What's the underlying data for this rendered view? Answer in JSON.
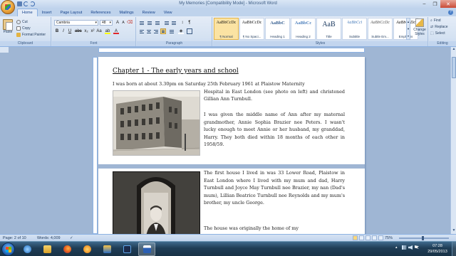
{
  "window": {
    "title": "My Memories [Compatibility Mode] - Microsoft Word",
    "minimize": "–",
    "maximize": "❐",
    "close": "✕"
  },
  "tabs": [
    "Home",
    "Insert",
    "Page Layout",
    "References",
    "Mailings",
    "Review",
    "View"
  ],
  "ribbon": {
    "clipboard": {
      "label": "Clipboard",
      "paste": "Paste",
      "cut": "Cut",
      "copy": "Copy",
      "format_painter": "Format Painter"
    },
    "font": {
      "label": "Font",
      "family": "Cambria",
      "size": "48",
      "bold": "B",
      "italic": "I",
      "underline": "U"
    },
    "paragraph": {
      "label": "Paragraph"
    },
    "styles": {
      "label": "Styles",
      "items": [
        {
          "preview": "AaBbCcDc",
          "name": "¶ Normal"
        },
        {
          "preview": "AaBbCcDc",
          "name": "¶ No Spaci..."
        },
        {
          "preview": "AaBbC",
          "name": "Heading 1"
        },
        {
          "preview": "AaBbCc",
          "name": "Heading 2"
        },
        {
          "preview": "AaB",
          "name": "Title"
        },
        {
          "preview": "AaBbCcl",
          "name": "Subtitle"
        },
        {
          "preview": "AaBbCcDc",
          "name": "Subtle Em..."
        },
        {
          "preview": "AaBbCcDc",
          "name": "Emphasis"
        }
      ],
      "change_styles": "Change Styles"
    },
    "editing": {
      "label": "Editing",
      "find": "Find",
      "replace": "Replace",
      "select": "Select"
    }
  },
  "document": {
    "chapter_title": "Chapter 1 - The early years and school",
    "para1_lead": "I was born at about 3.30pm on Saturday 25th February 1961 at Plaistow Maternity",
    "para1_rest": "Hospital in East London (see photo on left) and christened Gillian Ann Turnbull.",
    "para2": "I was given the middle name of Ann after my maternal grandmother, Annie Sophia Brazier nee Peters. I wasn't lucky enough to meet Annie or her husband, my granddad, Harry. They both died within 18 months of each other in 1958/59.",
    "para3": "The first house I lived in was 33 Lower Road, Plaistow in East London where I lived with my mum and dad, Harry Turnbull and Joyce May Turnbull nee Brazier, my nan (Dad's mum), Lillian Beatrice Turnbull nee Reynolds and my mum's brother, my uncle George.",
    "para4": "The house was originally the home of my"
  },
  "status": {
    "page": "Page: 2 of 10",
    "words": "Words: 4,009",
    "zoom": "75%"
  },
  "taskbar": {
    "time": "07:28",
    "date": "29/05/2013",
    "apps": [
      "internet-explorer",
      "explorer",
      "firefox",
      "media-player",
      "outlook",
      "photoshop",
      "word"
    ]
  },
  "colors": {
    "ribbon_bg": "#d5e2f2",
    "workspace": "#9fb6d4",
    "taskbar": "#1f3d55"
  }
}
